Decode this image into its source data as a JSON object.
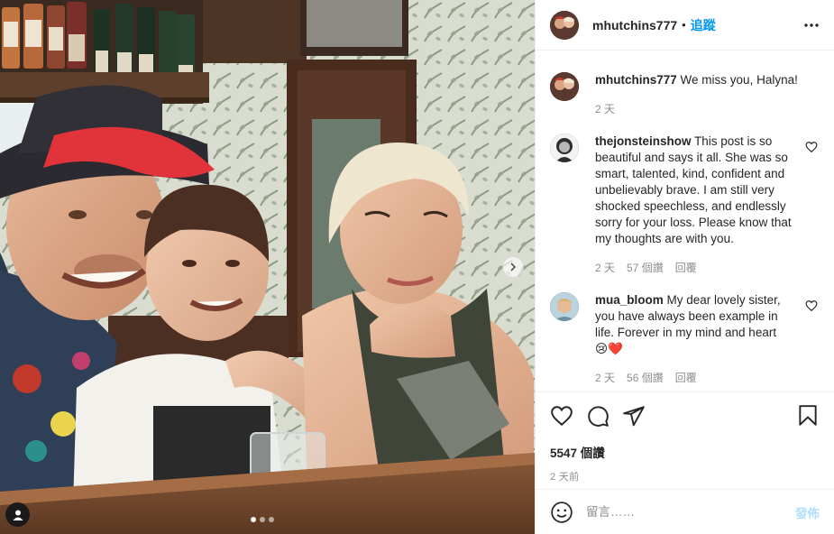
{
  "post": {
    "author": "mhutchins777",
    "separator": "•",
    "follow_label": "追蹤",
    "more_icon": "more-horizontal-icon",
    "image_count": 3,
    "active_image_index": 0
  },
  "comments": [
    {
      "username": "mhutchins777",
      "text": "We miss you, Halyna!",
      "age": "2 天",
      "likes": "",
      "reply_label": ""
    },
    {
      "username": "thejonsteinshow",
      "text": "This post is so beautiful and says it all. She was so smart, talented, kind, confident and unbelievably brave. I am still very shocked speechless, and endlessly sorry for your loss. Please know that my thoughts are with you.",
      "age": "2 天",
      "likes": "57 個讚",
      "reply_label": "回覆"
    },
    {
      "username": "mua_bloom",
      "text": "My dear lovely sister, you have always been example in life. Forever in my mind and heart",
      "emoji": "😢❤️",
      "age": "2 天",
      "likes": "56 個讚",
      "reply_label": "回覆"
    }
  ],
  "actions": {
    "like_icon": "heart-icon",
    "comment_icon": "comment-icon",
    "share_icon": "paper-plane-icon",
    "save_icon": "bookmark-icon",
    "likes_count": "5547 個讚",
    "posted": "2 天前"
  },
  "add_comment": {
    "placeholder": "留言……",
    "post_label": "發佈"
  },
  "colors": {
    "accent": "#0095f6",
    "post_disabled": "#b2dffc",
    "muted": "#8e8e8e"
  }
}
